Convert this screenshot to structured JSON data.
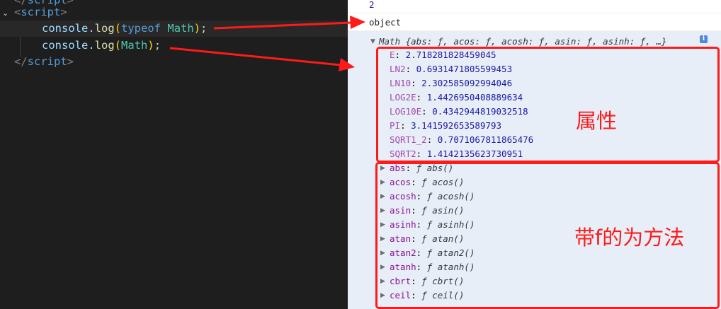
{
  "editor": {
    "top_fragment": "script",
    "open_tag_name": "script",
    "line1": {
      "object": "console",
      "method": "log",
      "keyword": "typeof",
      "arg": "Math"
    },
    "line2": {
      "object": "console",
      "method": "log",
      "arg": "Math"
    },
    "close_tag_name": "script"
  },
  "console": {
    "output_number": "2",
    "output_typeof": "object",
    "math_summary": "Math {abs: ƒ, acos: ƒ, acosh: ƒ, asin: ƒ, asinh: ƒ, …}",
    "properties": [
      {
        "name": "E",
        "value": "2.718281828459045"
      },
      {
        "name": "LN2",
        "value": "0.6931471805599453"
      },
      {
        "name": "LN10",
        "value": "2.302585092994046"
      },
      {
        "name": "LOG2E",
        "value": "1.4426950408889634"
      },
      {
        "name": "LOG10E",
        "value": "0.4342944819032518"
      },
      {
        "name": "PI",
        "value": "3.141592653589793"
      },
      {
        "name": "SQRT1_2",
        "value": "0.7071067811865476"
      },
      {
        "name": "SQRT2",
        "value": "1.4142135623730951"
      }
    ],
    "methods": [
      {
        "name": "abs",
        "sig": "ƒ abs()"
      },
      {
        "name": "acos",
        "sig": "ƒ acos()"
      },
      {
        "name": "acosh",
        "sig": "ƒ acosh()"
      },
      {
        "name": "asin",
        "sig": "ƒ asin()"
      },
      {
        "name": "asinh",
        "sig": "ƒ asinh()"
      },
      {
        "name": "atan",
        "sig": "ƒ atan()"
      },
      {
        "name": "atan2",
        "sig": "ƒ atan2()"
      },
      {
        "name": "atanh",
        "sig": "ƒ atanh()"
      },
      {
        "name": "cbrt",
        "sig": "ƒ cbrt()"
      },
      {
        "name": "ceil",
        "sig": "ƒ ceil()"
      }
    ]
  },
  "annotations": {
    "properties_label": "属性",
    "methods_label": "带f的为方法",
    "color": "#ff1a1a"
  }
}
